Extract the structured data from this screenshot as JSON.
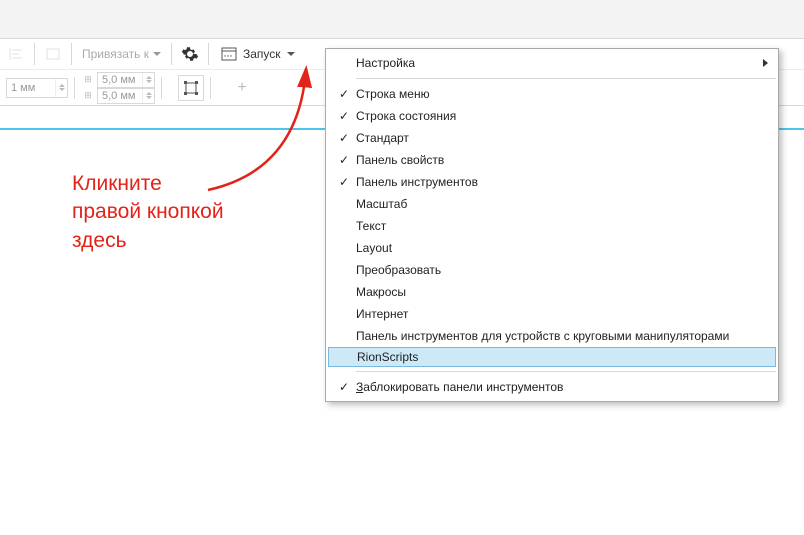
{
  "toolbar1": {
    "snap_label": "Привязать к",
    "launch_label": "Запуск"
  },
  "toolbar2": {
    "unit_value1": "1 мм",
    "spin_value_a": "5,0 мм",
    "spin_value_b": "5,0 мм"
  },
  "menu": {
    "customize": "Настройка",
    "items": [
      {
        "label": "Строка меню",
        "checked": true
      },
      {
        "label": "Строка состояния",
        "checked": true
      },
      {
        "label": "Стандарт",
        "checked": true
      },
      {
        "label": "Панель свойств",
        "checked": true
      },
      {
        "label": "Панель инструментов",
        "checked": true
      },
      {
        "label": "Масштаб",
        "checked": false
      },
      {
        "label": "Текст",
        "checked": false
      },
      {
        "label": "Layout",
        "checked": false
      },
      {
        "label": "Преобразовать",
        "checked": false
      },
      {
        "label": "Макросы",
        "checked": false
      },
      {
        "label": "Интернет",
        "checked": false
      },
      {
        "label": "Панель инструментов для устройств с круговыми манипуляторами",
        "checked": false
      }
    ],
    "highlighted": "RionScripts",
    "lock": {
      "label": "Заблокировать панели инструментов",
      "checked": true
    }
  },
  "hint": {
    "line1": "Кликните",
    "line2": "правой кнопкой",
    "line3": "здесь"
  }
}
